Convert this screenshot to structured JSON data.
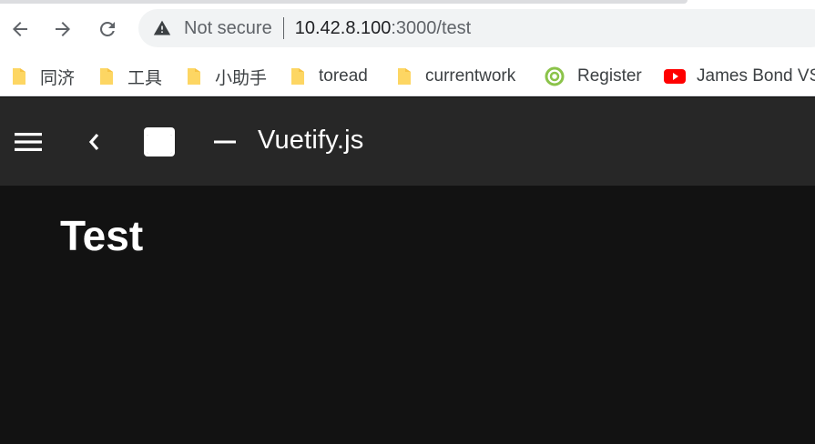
{
  "browser": {
    "address": {
      "security_label": "Not secure",
      "host": "10.42.8.100",
      "path": ":3000/test"
    },
    "bookmarks": [
      {
        "label": "同济",
        "icon": "folder-icon"
      },
      {
        "label": "工具",
        "icon": "folder-icon"
      },
      {
        "label": "小助手",
        "icon": "folder-icon"
      },
      {
        "label": "toread",
        "icon": "folder-icon"
      },
      {
        "label": "currentwork",
        "icon": "folder-icon"
      },
      {
        "label": "Register",
        "icon": "register-site-icon"
      },
      {
        "label": "James Bond VS",
        "icon": "youtube-icon"
      }
    ]
  },
  "app_bar": {
    "title": "Vuetify.js"
  },
  "main": {
    "heading": "Test"
  },
  "colors": {
    "app_bar_bg": "#272727",
    "content_bg": "#121212",
    "folder_yellow": "#fdd663",
    "youtube_red": "#ff0000",
    "register_green": "#8bc34a"
  }
}
